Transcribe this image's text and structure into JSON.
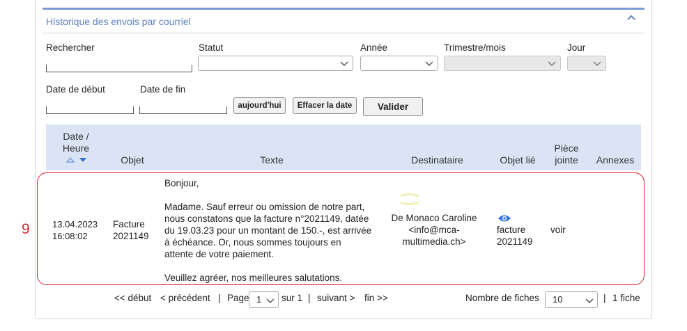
{
  "panel": {
    "title": "Historique des envois par courriel"
  },
  "filters": {
    "search_label": "Rechercher",
    "status_label": "Statut",
    "year_label": "Année",
    "quarter_label": "Trimestre/mois",
    "day_label": "Jour",
    "start_label": "Date de début",
    "end_label": "Date de fin",
    "today_button": "aujourd'hui",
    "clear_button": "Effacer la date",
    "submit_button": "Valider"
  },
  "table": {
    "headers": {
      "date_line1": "Date /",
      "date_line2": "Heure",
      "object": "Objet",
      "text": "Texte",
      "recipient": "Destinataire",
      "linked": "Objet lié",
      "piece_line1": "Pièce",
      "piece_line2": "jointe",
      "annexes": "Annexes"
    },
    "row": {
      "number": "9",
      "date": "13.04.2023",
      "time": "16:08:02",
      "object_line1": "Facture",
      "object_line2": "2021149",
      "text_greeting": "Bonjour,",
      "text_body_1": "Madame. Sauf erreur ou omission de notre part,",
      "text_body_2": "nous constatons que la facture n°2021149, datée",
      "text_body_3": "du 19.03.23 pour un montant de 150.-, est arrivée",
      "text_body_4": "à échéance. Or, nous sommes toujours en",
      "text_body_5": "attente de votre paiement.",
      "text_closing": "Veuillez agréer, nos meilleures salutations.",
      "recipient_name": "De Monaco Caroline",
      "recipient_email_1": "<info@mca-",
      "recipient_email_2": "multimedia.ch>",
      "linked_line1": "facture",
      "linked_line2": "2021149",
      "attachment": "voir"
    }
  },
  "pager": {
    "first": "<< début",
    "prev": "< précédent",
    "sep": "|",
    "page_label": "Page",
    "page_value": "1",
    "of": "sur 1",
    "next": "suivant >",
    "last": "fin >>",
    "per_page_label": "Nombre de fiches",
    "per_page_value": "10",
    "count": "1 fiche"
  },
  "colors": {
    "accent": "#5e80c4",
    "header_bg": "#dbe4f5",
    "outline": "#d8202f",
    "eye": "#2f6fd6"
  },
  "icons": [
    "chevron-up-icon",
    "chevron-down-icon",
    "sort-asc-icon",
    "sort-desc-icon",
    "eye-icon"
  ]
}
